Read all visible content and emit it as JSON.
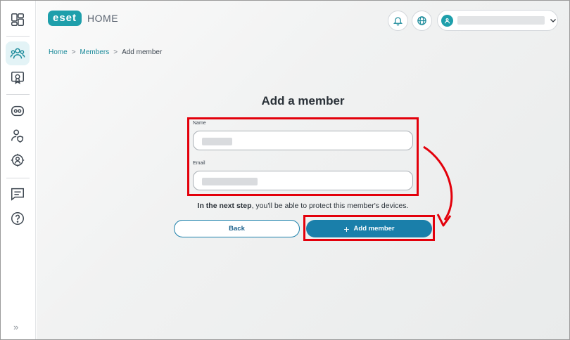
{
  "app": {
    "logo": "eset",
    "product": "HOME"
  },
  "sidebar": {
    "items": [
      {
        "icon": "dashboard-icon",
        "active": false
      },
      {
        "icon": "members-icon",
        "active": true
      },
      {
        "icon": "license-icon",
        "active": false
      },
      {
        "icon": "devices-icon",
        "active": false
      },
      {
        "icon": "user-security-icon",
        "active": false
      },
      {
        "icon": "anti-theft-icon",
        "active": false
      },
      {
        "icon": "chat-icon",
        "active": false
      },
      {
        "icon": "help-icon",
        "active": false
      }
    ],
    "expand_label": "»"
  },
  "breadcrumb": {
    "home": "Home",
    "members": "Members",
    "current": "Add member",
    "separator": ">"
  },
  "page": {
    "title": "Add a member"
  },
  "form": {
    "name_label": "Name",
    "email_label": "Email"
  },
  "hint": {
    "bold": "In the next step",
    "rest": ", you'll be able to protect this member's devices."
  },
  "buttons": {
    "back": "Back",
    "add_member": "Add member",
    "add_icon": "+"
  },
  "colors": {
    "accent": "#1a7faa",
    "teal": "#1e9fab",
    "highlight": "#e3000b"
  }
}
